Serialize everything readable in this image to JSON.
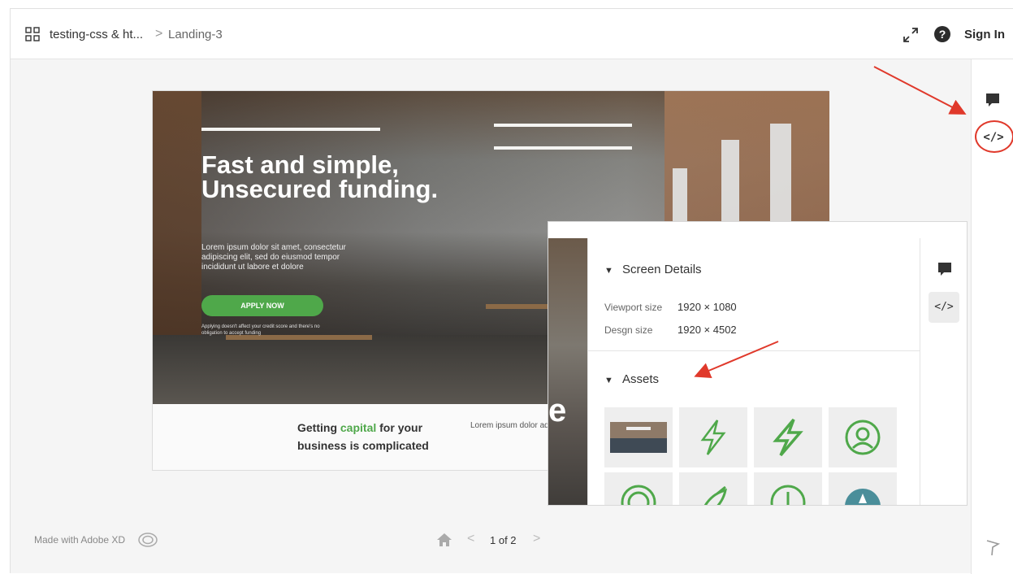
{
  "header": {
    "project_name": "testing-css & ht...",
    "separator": ">",
    "screen_name": "Landing-3",
    "sign_in_label": "Sign In",
    "help_glyph": "?"
  },
  "right_rail": {
    "code_glyph": "</>",
    "icons": [
      "comment-icon",
      "code-icon",
      "flag-icon"
    ]
  },
  "artboard": {
    "hero_title": "Fast and simple, Unsecured funding.",
    "hero_body": "Lorem ipsum dolor sit amet, consectetur adipiscing elit, sed do eiusmod tempor incididunt ut labore et dolore",
    "apply_button": "APPLY NOW",
    "hero_fine_print": "Applying doesn't affect your credit score and there's no obligation to accept funding",
    "band_heading_pre": "Getting ",
    "band_heading_accent": "capital",
    "band_heading_post": " for your business is complicated",
    "band_body": "Lorem ipsum dolor adipiscing elit, sed ut labore et dolore"
  },
  "inspect_panel": {
    "photo_letter": "e",
    "screen_details_title": "Screen Details",
    "viewport_label": "Viewport size",
    "viewport_value": "1920 × 1080",
    "design_label": "Desgn size",
    "design_value": "1920 × 4502",
    "assets_title": "Assets",
    "code_glyph": "</>",
    "assets": [
      "office-photo",
      "lightning-outline-icon",
      "lightning-bold-icon",
      "user-circle-icon",
      "target-icon",
      "rocket-icon",
      "dollar-circle-icon",
      "cloud-icon"
    ]
  },
  "footer": {
    "made_with": "Made with Adobe XD",
    "page_indicator": "1 of 2",
    "prev": "<",
    "next": ">"
  },
  "colors": {
    "accent_green": "#4fa84a",
    "annotation_red": "#e0392b"
  }
}
